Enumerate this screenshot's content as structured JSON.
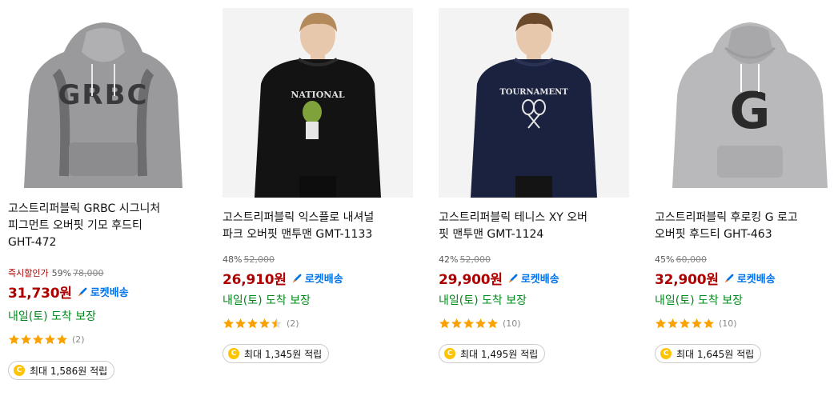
{
  "colors": {
    "price": "#ae0000",
    "rocket": "#0073e9",
    "arrival": "#00891a",
    "star": "#f8a100",
    "coin": "#ffc400"
  },
  "products": [
    {
      "title_lines": [
        "고스트리퍼블릭 GRBC 시그니처",
        "피그먼트 오버핏 기모 후드티",
        "GHT-472"
      ],
      "instant_label": "즉시할인가",
      "discount": "59%",
      "original_price": "78,000",
      "price": "31,730원",
      "rocket_label": "로켓배송",
      "rocket_icon": "rocket-icon",
      "arrival": "내일(토) 도착 보장",
      "rating": 5,
      "review_count": "(2)",
      "reward": "최대 1,586원 적립",
      "coin_label": "C",
      "image": "grey-grbc-hoodie"
    },
    {
      "title_lines": [
        "고스트리퍼블릭 익스플로 내셔널",
        "파크 오버핏 맨투맨 GMT-1133"
      ],
      "instant_label": "",
      "discount": "48%",
      "original_price": "52,000",
      "price": "26,910원",
      "rocket_label": "로켓배송",
      "rocket_icon": "rocket-icon",
      "arrival": "내일(토) 도착 보장",
      "rating": 4.5,
      "review_count": "(2)",
      "reward": "최대 1,345원 적립",
      "coin_label": "C",
      "image": "black-national-sweatshirt"
    },
    {
      "title_lines": [
        "고스트리퍼블릭 테니스 XY 오버",
        "핏 맨투맨 GMT-1124"
      ],
      "instant_label": "",
      "discount": "42%",
      "original_price": "52,000",
      "price": "29,900원",
      "rocket_label": "로켓배송",
      "rocket_icon": "rocket-icon",
      "arrival": "내일(토) 도착 보장",
      "rating": 5,
      "review_count": "(10)",
      "reward": "최대 1,495원 적립",
      "coin_label": "C",
      "image": "navy-tournament-sweatshirt"
    },
    {
      "title_lines": [
        "고스트리퍼블릭 후로킹 G 로고",
        "오버핏 후드티 GHT-463"
      ],
      "instant_label": "",
      "discount": "45%",
      "original_price": "60,000",
      "price": "32,900원",
      "rocket_label": "로켓배송",
      "rocket_icon": "rocket-icon",
      "arrival": "내일(토) 도착 보장",
      "rating": 5,
      "review_count": "(10)",
      "reward": "최대 1,645원 적립",
      "coin_label": "C",
      "image": "grey-g-logo-hoodie"
    }
  ]
}
